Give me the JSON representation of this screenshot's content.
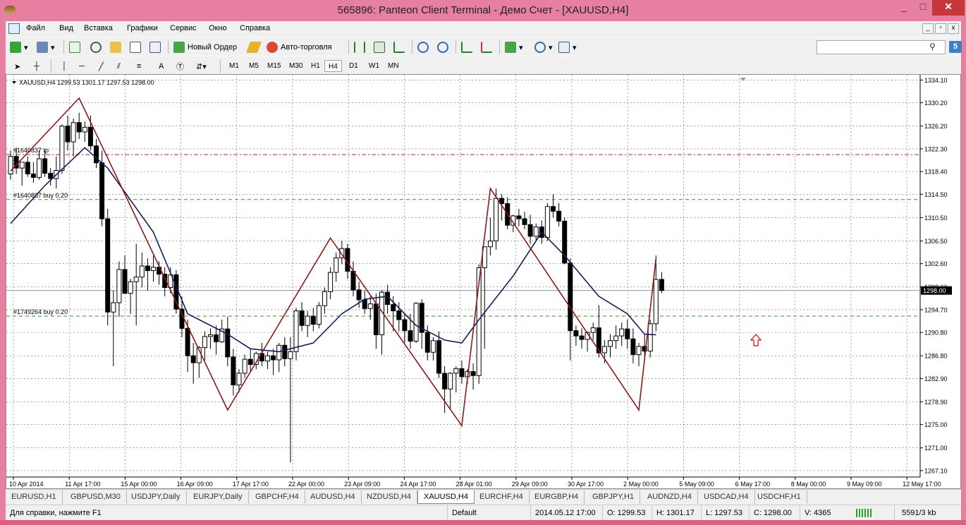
{
  "window": {
    "title": "565896: Panteon Client Terminal - Демо Счет - [XAUUSD,H4]",
    "min_glyph": "_",
    "max_glyph": "□",
    "close_glyph": "✕"
  },
  "menu": [
    "Файл",
    "Вид",
    "Вставка",
    "Графики",
    "Сервис",
    "Окно",
    "Справка"
  ],
  "mdi": {
    "min_glyph": "_",
    "restore_glyph": "▫",
    "close_glyph": "x"
  },
  "toolbar1": {
    "new_order": "Новый Ордер",
    "auto_trading": "Авто-торговля"
  },
  "toolbar2": {
    "text_tool": "A",
    "timeframes": [
      "M1",
      "M5",
      "M15",
      "M30",
      "H1",
      "H4",
      "D1",
      "W1",
      "MN"
    ],
    "active_timeframe": "H4"
  },
  "search": {
    "placeholder": "",
    "badge": "5"
  },
  "chart_data": {
    "type": "candlestick",
    "header": "XAUUSD,H4  1299.53 1301.17 1297.53 1298.00",
    "current_price": "1298.00",
    "ylim": [
      1266,
      1335
    ],
    "y_ticks": [
      "1334.10",
      "1330.20",
      "1326.20",
      "1322.30",
      "1318.40",
      "1314.50",
      "1310.50",
      "1306.50",
      "1302.60",
      "1298.60",
      "1294.70",
      "1290.80",
      "1286.80",
      "1282.90",
      "1278.90",
      "1275.00",
      "1271.00",
      "1267.10"
    ],
    "x_ticks": [
      "10 Apr 2014",
      "11 Apr 17:00",
      "15 Apr 00:00",
      "16 Apr 09:00",
      "17 Apr 17:00",
      "22 Apr 00:00",
      "23 Apr 09:00",
      "24 Apr 17:00",
      "28 Apr 01:00",
      "29 Apr 09:00",
      "30 Apr 17:00",
      "2 May 00:00",
      "5 May 09:00",
      "6 May 17:00",
      "8 May 00:00",
      "9 May 09:00",
      "12 May 17:00"
    ],
    "order_labels": [
      {
        "text": "#1640837 tp",
        "price": 1321.3,
        "color": "#a52a2a"
      },
      {
        "text": "#1640837 buy 0.20",
        "price": 1313.6,
        "color": "#2e9a2e"
      },
      {
        "text": "#1749264 buy 0.20",
        "price": 1293.6,
        "color": "#2e9a2e"
      }
    ],
    "zigzag_points": [
      [
        0,
        1318.5
      ],
      [
        12,
        1331.0
      ],
      [
        38,
        1277.5
      ],
      [
        56,
        1307.0
      ],
      [
        79,
        1274.8
      ],
      [
        84,
        1315.5
      ],
      [
        110,
        1277.5
      ],
      [
        113,
        1303.5
      ]
    ],
    "ma_points": [
      [
        0,
        1309.5
      ],
      [
        6,
        1316.0
      ],
      [
        13,
        1322.5
      ],
      [
        17,
        1319.0
      ],
      [
        25,
        1308.0
      ],
      [
        31,
        1294.0
      ],
      [
        38,
        1290.5
      ],
      [
        42,
        1288.0
      ],
      [
        47,
        1287.5
      ],
      [
        53,
        1289.0
      ],
      [
        58,
        1294.0
      ],
      [
        62,
        1296.5
      ],
      [
        66,
        1297.0
      ],
      [
        71,
        1292.0
      ],
      [
        76,
        1289.5
      ],
      [
        79,
        1289.0
      ],
      [
        82,
        1293.0
      ],
      [
        88,
        1300.5
      ],
      [
        93,
        1308.0
      ],
      [
        97,
        1304.0
      ],
      [
        103,
        1297.0
      ],
      [
        108,
        1294.0
      ],
      [
        111,
        1290.5
      ],
      [
        113,
        1290.4
      ]
    ],
    "candles": [
      [
        1318.0,
        1322.0,
        1317.0,
        1321.0
      ],
      [
        1321.0,
        1322.5,
        1318.0,
        1319.0
      ],
      [
        1319.0,
        1320.0,
        1316.0,
        1320.0
      ],
      [
        1320.0,
        1321.0,
        1317.5,
        1318.0
      ],
      [
        1318.0,
        1320.0,
        1316.5,
        1317.4
      ],
      [
        1317.4,
        1322.0,
        1317.0,
        1320.6
      ],
      [
        1320.6,
        1322.0,
        1317.5,
        1318.1
      ],
      [
        1318.1,
        1319.0,
        1316.0,
        1317.2
      ],
      [
        1317.2,
        1321.0,
        1315.5,
        1318.6
      ],
      [
        1318.6,
        1326.5,
        1318.0,
        1326.2
      ],
      [
        1326.2,
        1328.0,
        1322.0,
        1323.5
      ],
      [
        1323.5,
        1327.5,
        1321.0,
        1326.8
      ],
      [
        1326.8,
        1328.5,
        1324.0,
        1325.2
      ],
      [
        1325.2,
        1327.0,
        1323.5,
        1326.0
      ],
      [
        1326.0,
        1328.0,
        1322.0,
        1322.8
      ],
      [
        1322.8,
        1324.0,
        1319.0,
        1319.9
      ],
      [
        1319.9,
        1322.0,
        1309.0,
        1310.3
      ],
      [
        1310.3,
        1312.0,
        1292.0,
        1294.3
      ],
      [
        1294.3,
        1298.0,
        1285.0,
        1295.9
      ],
      [
        1295.9,
        1303.0,
        1293.5,
        1301.6
      ],
      [
        1301.6,
        1304.0,
        1298.0,
        1297.5
      ],
      [
        1297.5,
        1300.0,
        1294.0,
        1299.5
      ],
      [
        1299.5,
        1306.0,
        1292.0,
        1300.3
      ],
      [
        1300.3,
        1304.5,
        1298.5,
        1302.2
      ],
      [
        1302.2,
        1303.5,
        1298.0,
        1301.4
      ],
      [
        1301.4,
        1304.0,
        1299.5,
        1302.0
      ],
      [
        1302.0,
        1303.0,
        1299.0,
        1300.8
      ],
      [
        1300.8,
        1302.0,
        1297.0,
        1298.5
      ],
      [
        1298.5,
        1302.0,
        1297.5,
        1300.7
      ],
      [
        1300.7,
        1301.5,
        1294.0,
        1294.8
      ],
      [
        1294.8,
        1297.0,
        1290.0,
        1291.5
      ],
      [
        1291.5,
        1293.0,
        1284.0,
        1286.8
      ],
      [
        1286.8,
        1289.0,
        1282.0,
        1285.6
      ],
      [
        1285.6,
        1288.5,
        1283.0,
        1288.2
      ],
      [
        1288.2,
        1291.0,
        1286.0,
        1290.1
      ],
      [
        1290.1,
        1291.5,
        1288.0,
        1290.4
      ],
      [
        1290.4,
        1292.0,
        1287.0,
        1289.2
      ],
      [
        1289.2,
        1293.0,
        1289.0,
        1291.4
      ],
      [
        1291.4,
        1293.5,
        1285.0,
        1286.6
      ],
      [
        1286.6,
        1288.0,
        1280.0,
        1281.8
      ],
      [
        1281.8,
        1284.5,
        1280.5,
        1283.8
      ],
      [
        1283.8,
        1287.0,
        1283.0,
        1286.2
      ],
      [
        1286.2,
        1288.0,
        1284.0,
        1285.3
      ],
      [
        1285.3,
        1287.5,
        1284.5,
        1287.2
      ],
      [
        1287.2,
        1289.0,
        1285.0,
        1285.9
      ],
      [
        1285.9,
        1287.5,
        1284.5,
        1286.8
      ],
      [
        1286.8,
        1288.0,
        1283.5,
        1286.1
      ],
      [
        1286.1,
        1289.0,
        1284.0,
        1288.6
      ],
      [
        1288.6,
        1290.0,
        1285.0,
        1286.3
      ],
      [
        1286.3,
        1290.0,
        1268.5,
        1287.5
      ],
      [
        1287.5,
        1295.0,
        1286.0,
        1294.5
      ],
      [
        1294.5,
        1296.0,
        1291.0,
        1292.0
      ],
      [
        1292.0,
        1294.5,
        1290.0,
        1293.6
      ],
      [
        1293.6,
        1295.0,
        1291.0,
        1292.2
      ],
      [
        1292.2,
        1296.0,
        1291.5,
        1295.4
      ],
      [
        1295.4,
        1298.5,
        1294.0,
        1297.8
      ],
      [
        1297.8,
        1302.0,
        1296.5,
        1301.1
      ],
      [
        1301.1,
        1304.5,
        1299.5,
        1303.6
      ],
      [
        1303.6,
        1306.5,
        1302.5,
        1305.2
      ],
      [
        1305.2,
        1306.0,
        1300.0,
        1301.3
      ],
      [
        1301.3,
        1303.0,
        1297.0,
        1298.1
      ],
      [
        1298.1,
        1299.5,
        1295.0,
        1296.4
      ],
      [
        1296.4,
        1298.0,
        1294.0,
        1294.9
      ],
      [
        1294.9,
        1297.0,
        1293.0,
        1295.7
      ],
      [
        1295.7,
        1297.5,
        1288.0,
        1290.4
      ],
      [
        1290.4,
        1298.0,
        1287.0,
        1297.7
      ],
      [
        1297.7,
        1299.0,
        1294.0,
        1295.6
      ],
      [
        1295.6,
        1297.0,
        1291.0,
        1294.5
      ],
      [
        1294.5,
        1296.0,
        1291.0,
        1293.0
      ],
      [
        1293.0,
        1294.0,
        1289.0,
        1291.1
      ],
      [
        1291.1,
        1294.0,
        1288.0,
        1289.3
      ],
      [
        1289.3,
        1296.0,
        1289.0,
        1295.8
      ],
      [
        1295.8,
        1296.5,
        1288.0,
        1290.8
      ],
      [
        1290.8,
        1292.0,
        1286.0,
        1287.4
      ],
      [
        1287.4,
        1290.0,
        1286.0,
        1289.4
      ],
      [
        1289.4,
        1291.0,
        1283.0,
        1283.8
      ],
      [
        1283.8,
        1285.0,
        1277.0,
        1281.1
      ],
      [
        1281.1,
        1284.0,
        1277.5,
        1283.8
      ],
      [
        1283.8,
        1285.0,
        1280.5,
        1284.6
      ],
      [
        1284.6,
        1286.0,
        1282.0,
        1283.2
      ],
      [
        1283.2,
        1284.5,
        1282.0,
        1284.1
      ],
      [
        1284.1,
        1285.5,
        1281.0,
        1283.4
      ],
      [
        1283.4,
        1302.5,
        1282.0,
        1301.9
      ],
      [
        1301.9,
        1305.5,
        1288.0,
        1305.5
      ],
      [
        1305.5,
        1310.5,
        1304.0,
        1306.5
      ],
      [
        1306.5,
        1315.5,
        1305.0,
        1313.8
      ],
      [
        1313.8,
        1314.5,
        1310.0,
        1312.9
      ],
      [
        1312.9,
        1314.0,
        1308.5,
        1309.2
      ],
      [
        1309.2,
        1311.0,
        1308.0,
        1310.8
      ],
      [
        1310.8,
        1312.0,
        1309.0,
        1310.3
      ],
      [
        1310.3,
        1311.5,
        1308.5,
        1309.3
      ],
      [
        1309.3,
        1311.0,
        1306.0,
        1307.3
      ],
      [
        1307.3,
        1309.5,
        1306.5,
        1308.9
      ],
      [
        1308.9,
        1310.0,
        1306.0,
        1307.1
      ],
      [
        1307.1,
        1313.0,
        1306.5,
        1312.4
      ],
      [
        1312.4,
        1314.5,
        1310.5,
        1311.6
      ],
      [
        1311.6,
        1313.0,
        1309.0,
        1309.9
      ],
      [
        1309.9,
        1310.5,
        1302.5,
        1302.7
      ],
      [
        1302.7,
        1303.5,
        1286.0,
        1291.1
      ],
      [
        1291.1,
        1292.0,
        1288.5,
        1290.2
      ],
      [
        1290.2,
        1291.5,
        1288.0,
        1289.6
      ],
      [
        1289.6,
        1291.0,
        1287.5,
        1290.8
      ],
      [
        1290.8,
        1292.5,
        1289.5,
        1291.6
      ],
      [
        1291.6,
        1295.5,
        1286.5,
        1287.3
      ],
      [
        1287.3,
        1289.5,
        1285.5,
        1288.4
      ],
      [
        1288.4,
        1290.5,
        1286.5,
        1289.4
      ],
      [
        1289.4,
        1292.0,
        1288.0,
        1290.2
      ],
      [
        1290.2,
        1292.5,
        1288.5,
        1291.4
      ],
      [
        1291.4,
        1293.0,
        1288.0,
        1289.7
      ],
      [
        1289.7,
        1291.5,
        1285.5,
        1287.0
      ],
      [
        1287.0,
        1289.0,
        1285.0,
        1288.4
      ],
      [
        1288.4,
        1290.5,
        1286.0,
        1287.6
      ],
      [
        1287.6,
        1293.0,
        1286.5,
        1292.3
      ],
      [
        1292.3,
        1304.0,
        1291.0,
        1299.9
      ],
      [
        1299.9,
        1301.17,
        1297.53,
        1298.0
      ]
    ]
  },
  "tabs": [
    "EURUSD,H1",
    "GBPUSD,M30",
    "USDJPY,Daily",
    "EURJPY,Daily",
    "GBPCHF,H4",
    "AUDUSD,H4",
    "NZDUSD,H4",
    "XAUUSD,H4",
    "EURCHF,H4",
    "EURGBP,H4",
    "GBPJPY,H1",
    "AUDNZD,H4",
    "USDCAD,H4",
    "USDCHF,H1"
  ],
  "active_tab": "XAUUSD,H4",
  "status": {
    "help": "Для справки, нажмите F1",
    "profile": "Default",
    "datetime": "2014.05.12 17:00",
    "open": "O: 1299.53",
    "high": "H: 1301.17",
    "low": "L: 1297.53",
    "close": "C: 1298.00",
    "volume": "V: 4365",
    "traffic": "5591/3 kb"
  },
  "colors": {
    "bull": "#ffffff",
    "bear": "#000000",
    "zigzag": "#8b1a1a",
    "ma": "#1a1a5a",
    "tp_line": "#a52a2a",
    "buy_line": "#2e9a2e",
    "bid_line": "#8e95a6",
    "arrow": "#e00000"
  }
}
